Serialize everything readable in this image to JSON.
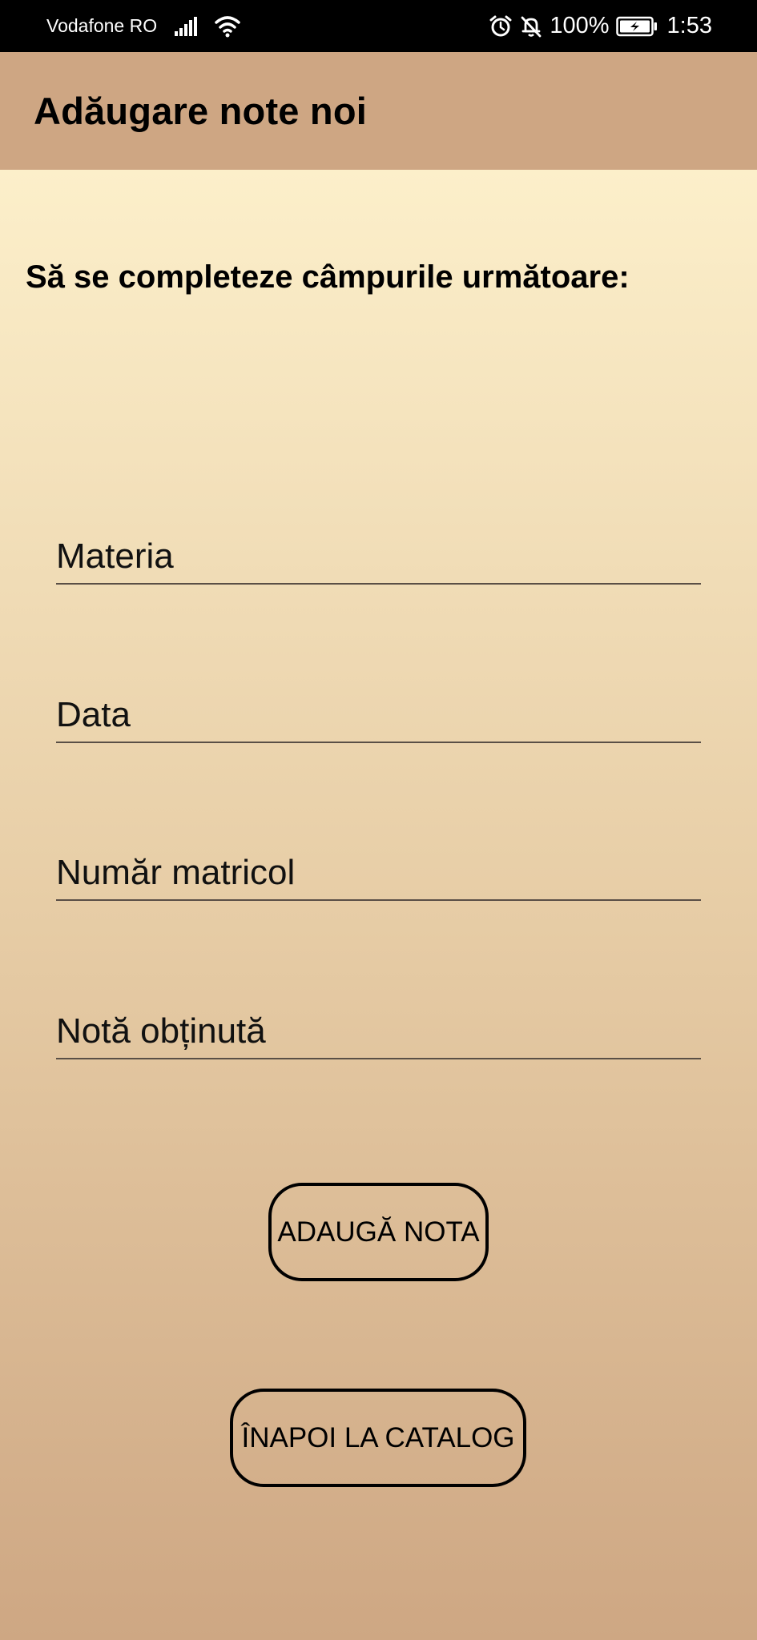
{
  "status_bar": {
    "carrier": "Vodafone RO",
    "battery_percent": "100%",
    "time": "1:53",
    "icons": [
      "signal-icon",
      "wifi-icon",
      "alarm-icon",
      "bell-off-icon",
      "battery-charging-icon"
    ]
  },
  "app_bar": {
    "title": "Adăugare note noi"
  },
  "form": {
    "instruction": "Să se completeze câmpurile următoare:",
    "fields": [
      {
        "placeholder": "Materia",
        "value": ""
      },
      {
        "placeholder": "Data",
        "value": ""
      },
      {
        "placeholder": "Număr matricol",
        "value": ""
      },
      {
        "placeholder": "Notă obținută",
        "value": ""
      }
    ],
    "add_button_label": "ADAUGĂ NOTA",
    "back_button_label": "ÎNAPOI LA CATALOG"
  },
  "colors": {
    "app_bar": "#cea683",
    "gradient_top": "#fcefca",
    "gradient_bottom": "#cea783",
    "status_bar": "#000000"
  }
}
